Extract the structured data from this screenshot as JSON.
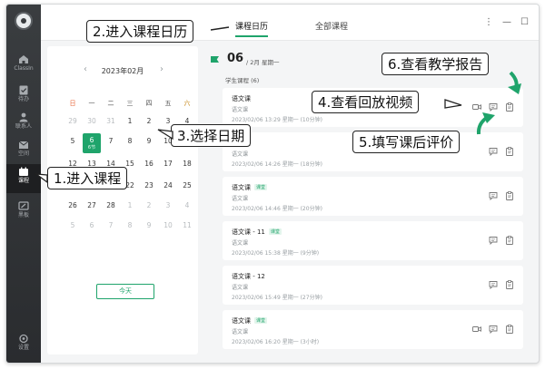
{
  "sidebar": {
    "items": [
      {
        "label": "ClassIn",
        "icon": "home-icon"
      },
      {
        "label": "待办",
        "icon": "todo-icon"
      },
      {
        "label": "联系人",
        "icon": "contacts-icon"
      },
      {
        "label": "空间",
        "icon": "space-icon"
      },
      {
        "label": "课程",
        "icon": "course-icon"
      },
      {
        "label": "黑板",
        "icon": "blackboard-icon"
      },
      {
        "label": "设置",
        "icon": "settings-icon"
      }
    ]
  },
  "tabs": {
    "calendar": "课程日历",
    "all": "全部课程"
  },
  "window_controls": {
    "menu": "⋮",
    "minimize": "—",
    "maximize": "☐",
    "close": "✕"
  },
  "calendar": {
    "month": "2023年02月",
    "prev": "‹",
    "next": "›",
    "weekdays": [
      "日",
      "一",
      "二",
      "三",
      "四",
      "五",
      "六"
    ],
    "rows": [
      [
        "29",
        "30",
        "31",
        "1",
        "2",
        "3",
        "4"
      ],
      [
        "5",
        "6",
        "7",
        "8",
        "9",
        "10",
        "11"
      ],
      [
        "12",
        "13",
        "14",
        "15",
        "16",
        "17",
        "18"
      ],
      [
        "19",
        "20",
        "21",
        "22",
        "23",
        "24",
        "25"
      ],
      [
        "26",
        "27",
        "28",
        "1",
        "2",
        "3",
        "4"
      ],
      [
        "5",
        "6",
        "7",
        "8",
        "9",
        "10",
        "11"
      ]
    ],
    "selected_sub": "6节",
    "today_button": "今天"
  },
  "list": {
    "date_day": "06",
    "date_rest": "/ 2月 星期一",
    "section": "学生课程 (6)",
    "courses": [
      {
        "title": "语文课",
        "badge": "",
        "subject": "语文课",
        "time": "2023/02/06 13:29 星期一 (10分钟)",
        "video": true
      },
      {
        "title": "语文课",
        "badge": "",
        "subject": "语文课",
        "time": "2023/02/06 14:26 星期一 (18分钟)",
        "video": false
      },
      {
        "title": "语文课",
        "badge": "课堂",
        "subject": "语文课",
        "time": "2023/02/06 14:46 星期一 (20分钟)",
        "video": false
      },
      {
        "title": "语文课 - 11",
        "badge": "课堂",
        "subject": "语文课",
        "time": "2023/02/06 15:38 星期一 (9分钟)",
        "video": false
      },
      {
        "title": "语文课 - 12",
        "badge": "",
        "subject": "语文课",
        "time": "2023/02/06 15:49 星期一 (27分钟)",
        "video": false
      },
      {
        "title": "语文课",
        "badge": "课堂",
        "subject": "语文课",
        "time": "2023/02/06 16:20 星期一 (3小时)",
        "video": true
      }
    ]
  },
  "annotations": {
    "a1": "1.进入课程",
    "a2": "2.进入课程日历",
    "a3": "3.选择日期",
    "a4": "4.查看回放视频",
    "a5": "5.填写课后评价",
    "a6": "6.查看教学报告"
  },
  "colors": {
    "accent": "#1fa46b",
    "sidebar": "#2f3235"
  }
}
